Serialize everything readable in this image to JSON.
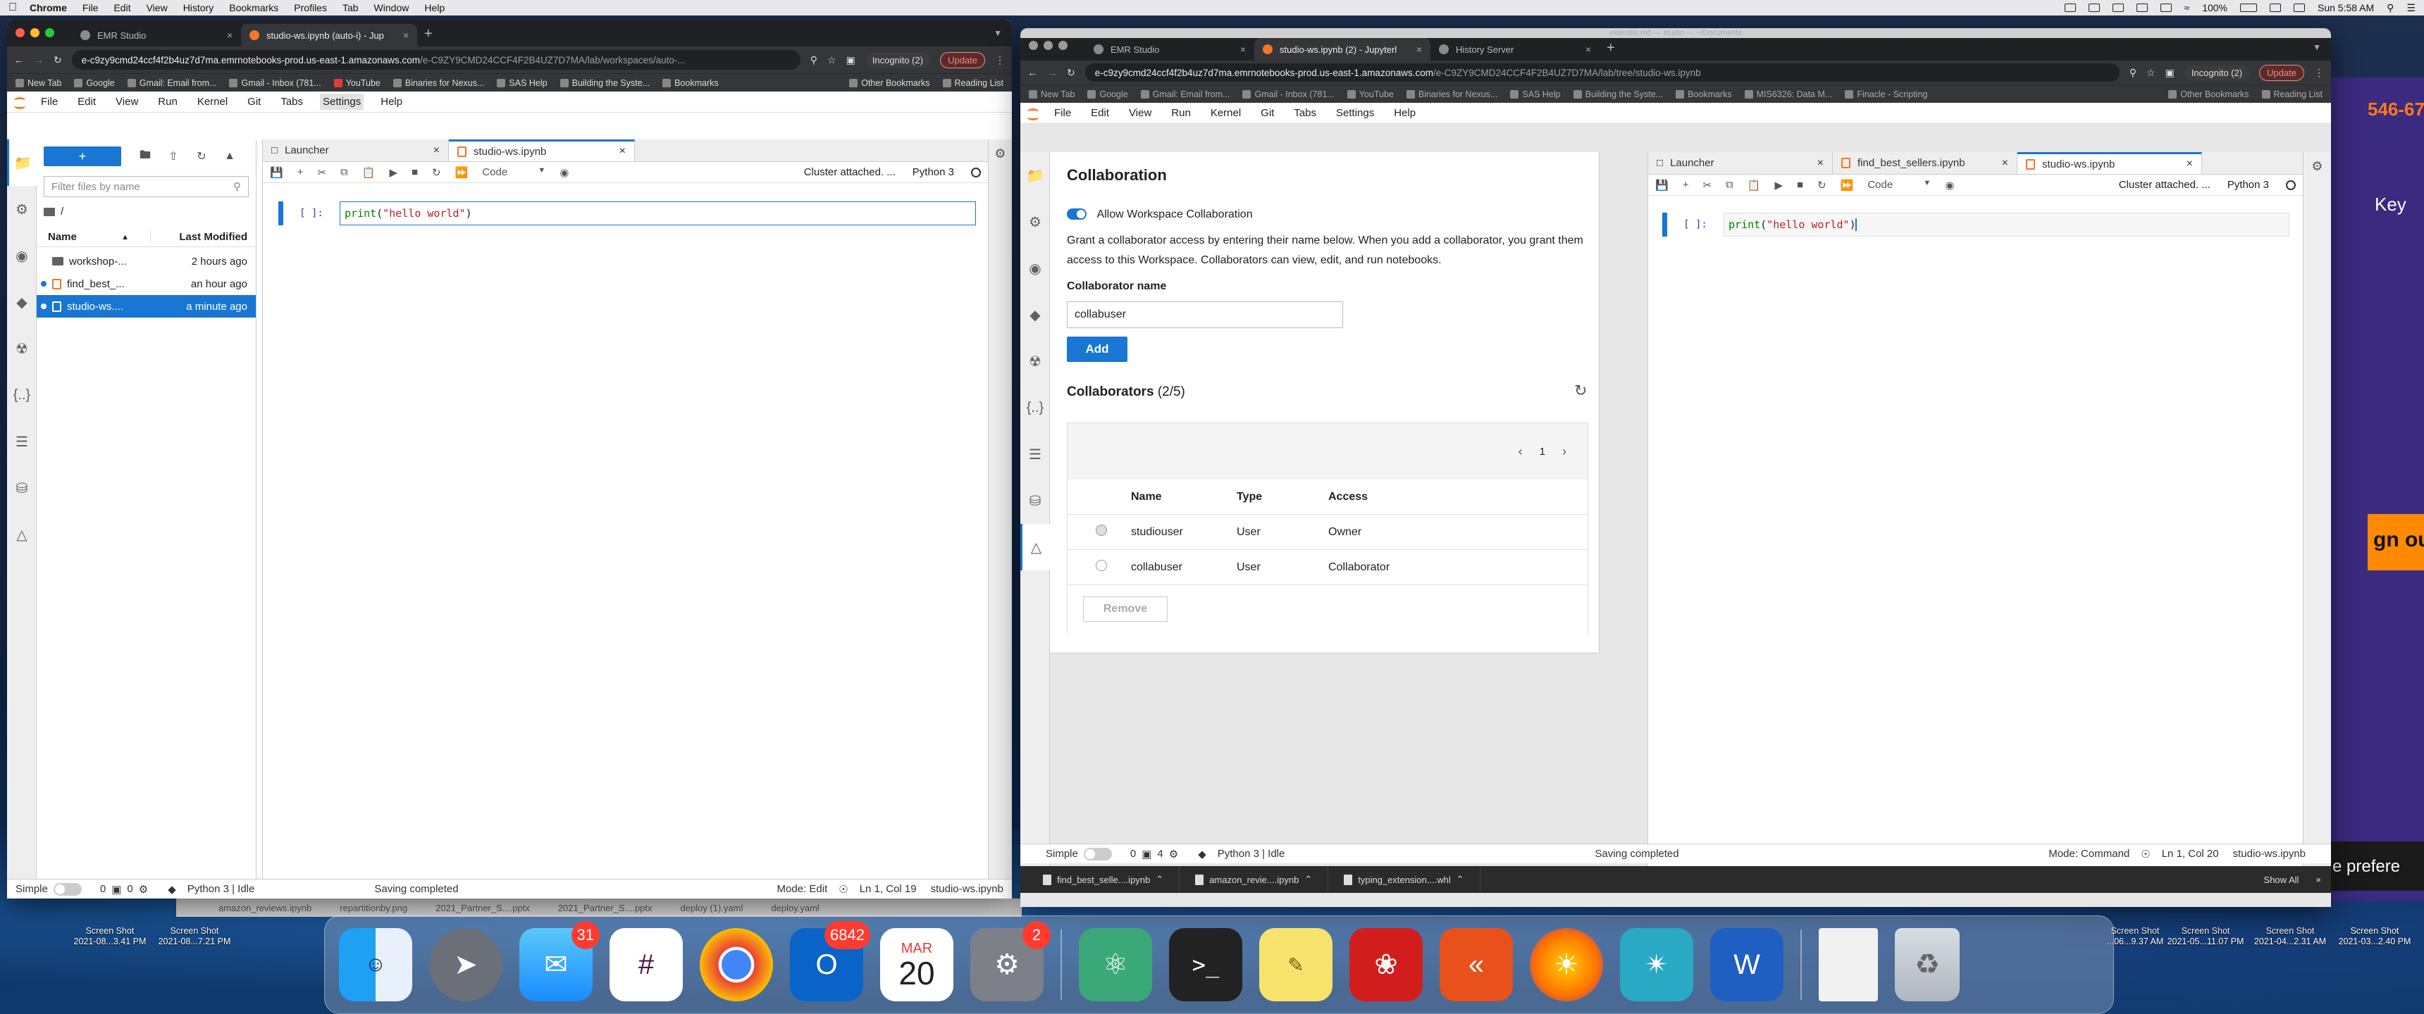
{
  "menubar": {
    "app": "Chrome",
    "items": [
      "File",
      "Edit",
      "View",
      "History",
      "Bookmarks",
      "Profiles",
      "Tab",
      "Window",
      "Help"
    ],
    "battery": "100%",
    "clock": "Sun 5:58 AM"
  },
  "left_window": {
    "tabs": [
      {
        "title": "EMR Studio"
      },
      {
        "title": "studio-ws.ipynb (auto-i) - Jup"
      }
    ],
    "new_tab": "+",
    "url_host": "e-c9zy9cmd24ccf4f2b4uz7d7ma.emrnotebooks-prod.us-east-1.amazonaws.com",
    "url_path": "/e-C9ZY9CMD24CCF4F2B4UZ7D7MA/lab/workspaces/auto-...",
    "incognito": "Incognito (2)",
    "update": "Update",
    "bookmarks": [
      "New Tab",
      "Google",
      "Gmail: Email from...",
      "Gmail - Inbox (781...",
      "YouTube",
      "Binaries for Nexus...",
      "SAS Help",
      "Building the Syste...",
      "Bookmarks"
    ],
    "bookmarks_right": [
      "Other Bookmarks",
      "Reading List"
    ],
    "jmenu": [
      "File",
      "Edit",
      "View",
      "Run",
      "Kernel",
      "Git",
      "Tabs",
      "Settings",
      "Help"
    ],
    "filter_placeholder": "Filter files by name",
    "path": "/",
    "col_name": "Name",
    "col_modified": "Last Modified",
    "files": [
      {
        "name": "workshop-...",
        "modified": "2 hours ago"
      },
      {
        "name": "find_best_...",
        "modified": "an hour ago"
      },
      {
        "name": "studio-ws....",
        "modified": "a minute ago"
      }
    ],
    "doc_tabs": [
      "Launcher",
      "studio-ws.ipynb"
    ],
    "cell_type": "Code",
    "cluster": "Cluster attached. ...",
    "kernel": "Python 3",
    "prompt": "[ ]:",
    "code_fn": "print",
    "code_open": "(",
    "code_str": "\"hello world\"",
    "code_close": ")",
    "status": {
      "mode_label": "Simple",
      "count_a": "0",
      "count_b": "0",
      "kernel": "Python 3 | Idle",
      "saving": "Saving completed",
      "mode": "Mode: Edit",
      "position": "Ln 1, Col 19",
      "file": "studio-ws.ipynb"
    }
  },
  "right_window": {
    "title_dim": "exercise.md — studio — ~/Documents",
    "tabs": [
      {
        "title": "EMR Studio"
      },
      {
        "title": "studio-ws.ipynb (2) - Jupyterl"
      },
      {
        "title": "History Server"
      }
    ],
    "new_tab": "+",
    "url_host": "e-c9zy9cmd24ccf4f2b4uz7d7ma.emrnotebooks-prod.us-east-1.amazonaws.com",
    "url_path": "/e-C9ZY9CMD24CCF4F2B4UZ7D7MA/lab/tree/studio-ws.ipynb",
    "incognito": "Incognito (2)",
    "update": "Update",
    "bookmarks": [
      "New Tab",
      "Google",
      "Gmail: Email from...",
      "Gmail - Inbox (781...",
      "YouTube",
      "Binaries for Nexus...",
      "SAS Help",
      "Building the Syste...",
      "Bookmarks",
      "MIS6326: Data M...",
      "Finacle - Scripting"
    ],
    "bookmarks_right": [
      "Other Bookmarks",
      "Reading List"
    ],
    "jmenu": [
      "File",
      "Edit",
      "View",
      "Run",
      "Kernel",
      "Git",
      "Tabs",
      "Settings",
      "Help"
    ],
    "collab": {
      "title": "Collaboration",
      "allow": "Allow Workspace Collaboration",
      "desc": "Grant a collaborator access by entering their name below. When you add a collaborator, you grant them access to this Workspace. Collaborators can view, edit, and run notebooks.",
      "name_label": "Collaborator name",
      "name_value": "collabuser",
      "add": "Add",
      "list_title": "Collaborators",
      "list_count": "(2/5)",
      "page": "1",
      "headers": [
        "Name",
        "Type",
        "Access"
      ],
      "rows": [
        {
          "name": "studiouser",
          "type": "User",
          "access": "Owner"
        },
        {
          "name": "collabuser",
          "type": "User",
          "access": "Collaborator"
        }
      ],
      "remove": "Remove"
    },
    "doc_tabs": [
      "Launcher",
      "find_best_sellers.ipynb",
      "studio-ws.ipynb"
    ],
    "cell_type": "Code",
    "cluster": "Cluster attached. ...",
    "kernel": "Python 3",
    "prompt": "[ ]:",
    "code_fn": "print",
    "code_open": "(",
    "code_str": "\"hello world\"",
    "code_close": ")",
    "status": {
      "mode_label": "Simple",
      "count_a": "0",
      "count_b": "4",
      "kernel": "Python 3 | Idle",
      "saving": "Saving completed",
      "mode": "Mode: Command",
      "position": "Ln 1, Col 20",
      "file": "studio-ws.ipynb"
    },
    "downloads": [
      "find_best_selle....ipynb",
      "amazon_revie....ipynb",
      "typing_extension....whl"
    ],
    "show_all": "Show All"
  },
  "background_strip": {
    "items": [
      "amazon_reviews.ipynb",
      "repartitionby.png",
      "2021_Partner_S....pptx",
      "2021_Partner_S....pptx",
      "deploy (1).yaml",
      "deploy.yaml"
    ]
  },
  "far_right": {
    "text1": "546-67",
    "text2": "Key",
    "text3": "gn ou",
    "text4": "e prefere"
  },
  "desktop_shots": [
    {
      "l1": "Screen Shot",
      "l2": "2021-08...3.41 PM"
    },
    {
      "l1": "Screen Shot",
      "l2": "2021-08...7.21 PM"
    },
    {
      "l1": "Screen Shot",
      "l2": "...06...9.37 AM"
    },
    {
      "l1": "Screen Shot",
      "l2": "2021-05...11.07 PM"
    },
    {
      "l1": "Screen Shot",
      "l2": "2021-04...2.31 AM"
    },
    {
      "l1": "Screen Shot",
      "l2": "2021-03...2.40 PM"
    }
  ],
  "dock": {
    "messages_badge": "31",
    "outlook_badge": "6842",
    "calendar_month": "MAR",
    "calendar_day": "20",
    "prefs_badge": "2"
  }
}
